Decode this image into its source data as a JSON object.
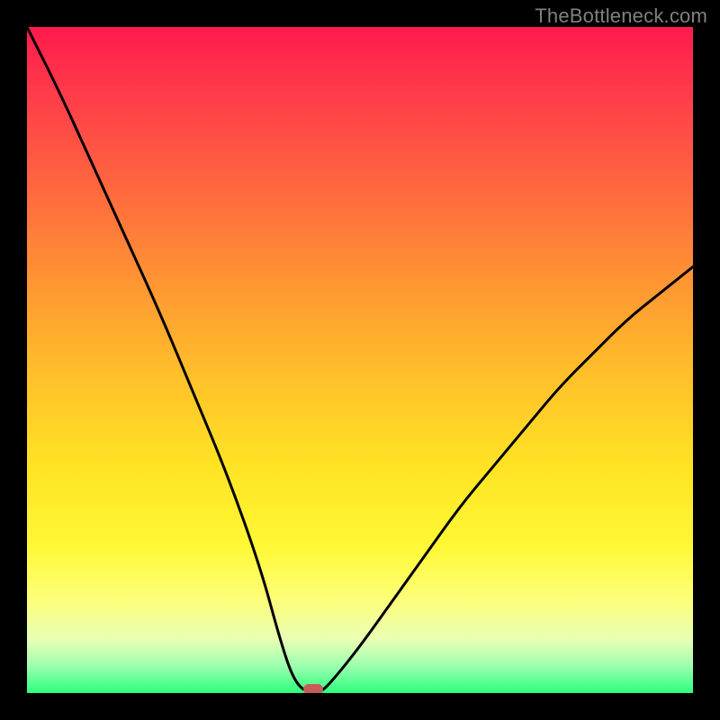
{
  "watermark": {
    "text": "TheBottleneck.com"
  },
  "chart_data": {
    "type": "line",
    "title": "",
    "xlabel": "",
    "ylabel": "",
    "xlim": [
      0,
      100
    ],
    "ylim": [
      0,
      100
    ],
    "x": [
      0,
      5,
      10,
      15,
      20,
      25,
      30,
      35,
      38,
      40,
      42,
      44,
      46,
      50,
      55,
      60,
      65,
      70,
      75,
      80,
      85,
      90,
      95,
      100
    ],
    "values": [
      100,
      90,
      79,
      68,
      57,
      45,
      33,
      19,
      8,
      2,
      0,
      0,
      2,
      7,
      14,
      21,
      28,
      34,
      40,
      46,
      51,
      56,
      60,
      64
    ],
    "marker": {
      "x": 43,
      "y": 0
    },
    "gradient_stops": [
      {
        "pos": 0,
        "color": "#ff1a4d"
      },
      {
        "pos": 25,
        "color": "#ff6a3e"
      },
      {
        "pos": 52,
        "color": "#ffbf2a"
      },
      {
        "pos": 78,
        "color": "#fff835"
      },
      {
        "pos": 96,
        "color": "#9cffb0"
      },
      {
        "pos": 100,
        "color": "#2cff7a"
      }
    ]
  }
}
